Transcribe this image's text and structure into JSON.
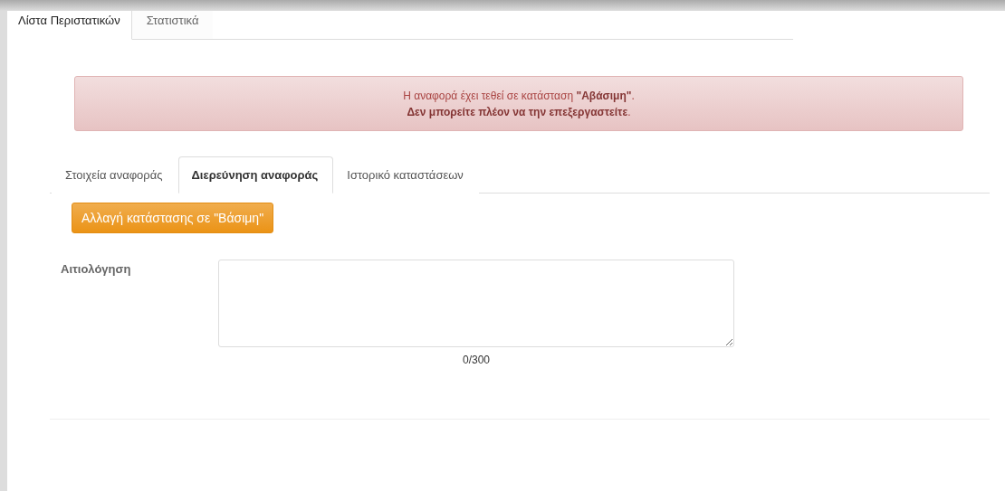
{
  "top_tabs": [
    {
      "label": "Λίστα Περιστατικών",
      "selected": true
    },
    {
      "label": "Στατιστικά",
      "selected": false
    }
  ],
  "alert": {
    "lines": [
      "Η αναφορά έχει τεθεί σε κατάσταση **\"Αβάσιμη\"**.",
      "**Δεν μπορείτε πλέον να την επεξεργαστείτε**."
    ]
  },
  "tabs": [
    {
      "label": "Στοιχεία αναφοράς",
      "selected": false
    },
    {
      "label": "Διερεύνηση αναφοράς",
      "selected": true
    },
    {
      "label": "Ιστορικό καταστάσεων",
      "selected": false
    }
  ],
  "action_button": "Αλλαγή κατάστασης σε \"Βάσιμη\"",
  "form": {
    "label": "Αιτιολόγηση",
    "counter": "0/300"
  }
}
